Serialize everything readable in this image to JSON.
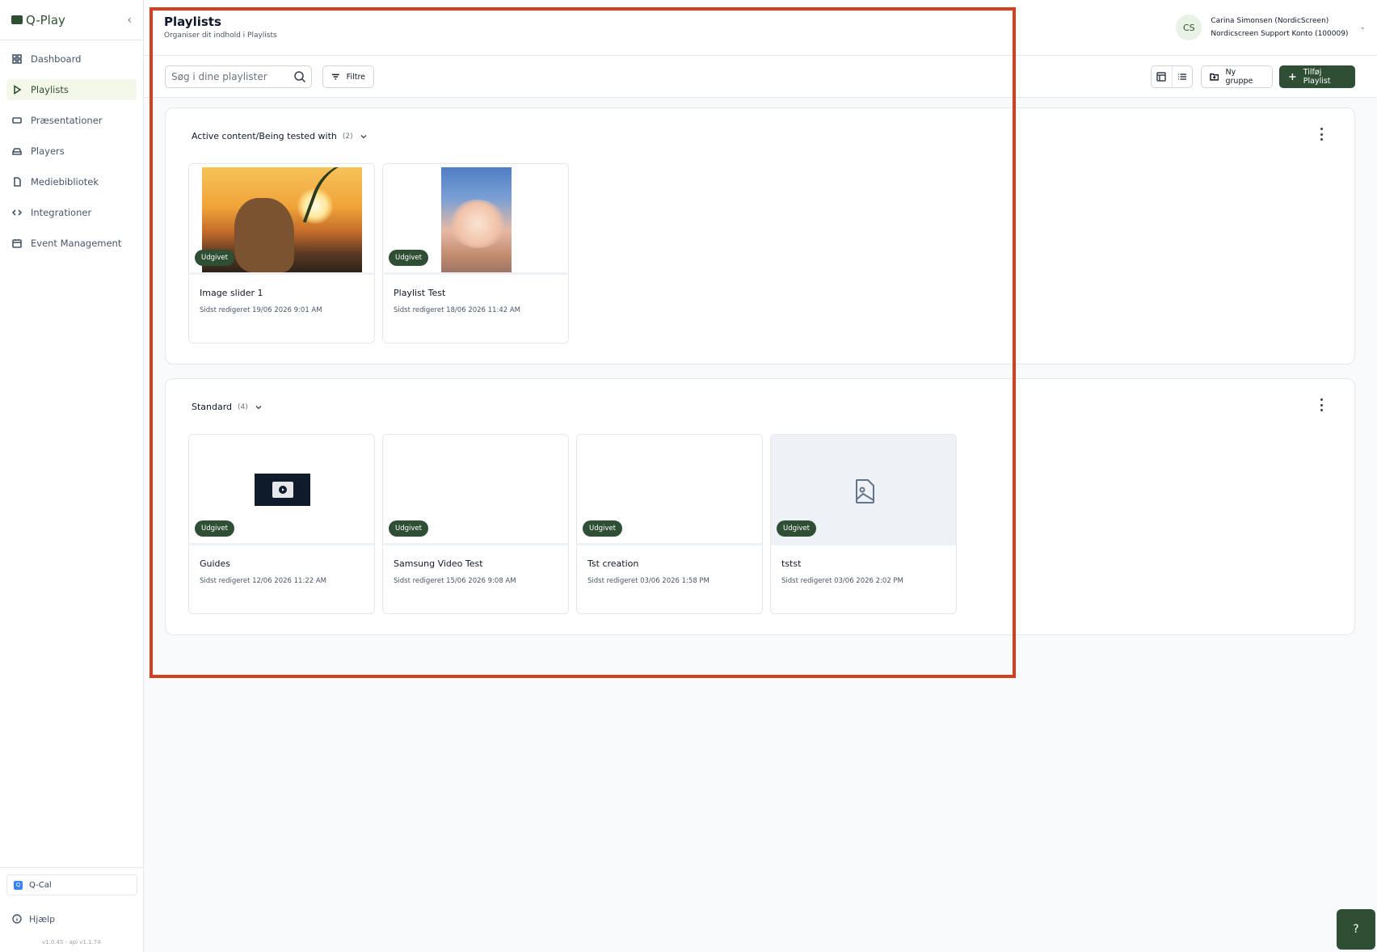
{
  "brand": {
    "name": "Q-Play"
  },
  "nav": {
    "items": [
      {
        "label": "Dashboard",
        "icon": "dashboard-icon"
      },
      {
        "label": "Playlists",
        "icon": "play-icon",
        "active": true
      },
      {
        "label": "Præsentationer",
        "icon": "presentation-icon"
      },
      {
        "label": "Players",
        "icon": "player-icon"
      },
      {
        "label": "Mediebibliotek",
        "icon": "file-icon"
      },
      {
        "label": "Integrationer",
        "icon": "code-icon"
      },
      {
        "label": "Event Management",
        "icon": "calendar-icon"
      }
    ]
  },
  "sidebar_bottom": {
    "qcal_label": "Q-Cal",
    "help_label": "Hjælp",
    "version": "v1.0.45 - api v1.1.74"
  },
  "header": {
    "title": "Playlists",
    "subtitle": "Organiser dit indhold i Playlists",
    "user_initials": "CS",
    "user_name": "Carina Simonsen (NordicScreen)",
    "user_account": "Nordicscreen Support Konto (100009)"
  },
  "toolbar": {
    "search_placeholder": "Søg i dine playlister",
    "filter_label": "Filtre",
    "new_group_label": "Ny gruppe",
    "add_playlist_label": "Tilføj Playlist"
  },
  "groups": [
    {
      "title": "Active content/Being tested with",
      "count": "(2)",
      "cards": [
        {
          "title": "Image slider 1",
          "badge": "Udgivet",
          "date": "Sidst redigeret 19/06 2026 9:01 AM",
          "thumb": "sunset-dog-photo"
        },
        {
          "title": "Playlist Test",
          "badge": "Udgivet",
          "date": "Sidst redigeret 18/06 2026 11:42 AM",
          "thumb": "cloud-photo"
        }
      ]
    },
    {
      "title": "Standard",
      "count": "(4)",
      "cards": [
        {
          "title": "Guides",
          "badge": "Udgivet",
          "date": "Sidst redigeret 12/06 2026 11:22 AM",
          "thumb": "video-thumbnail"
        },
        {
          "title": "Samsung Video Test",
          "badge": "Udgivet",
          "date": "Sidst redigeret 15/06 2026 9:08 AM",
          "thumb": "blank"
        },
        {
          "title": "Tst creation",
          "badge": "Udgivet",
          "date": "Sidst redigeret 03/06 2026 1:58 PM",
          "thumb": "blank"
        },
        {
          "title": "tstst",
          "badge": "Udgivet",
          "date": "Sidst redigeret 03/06 2026 2:02 PM",
          "thumb": "image-placeholder-icon"
        }
      ]
    }
  ],
  "fab": {
    "label": "?"
  },
  "colors": {
    "brand": "#2f4f35",
    "highlight": "#d2401f",
    "active_nav": "#f4f8e9"
  }
}
